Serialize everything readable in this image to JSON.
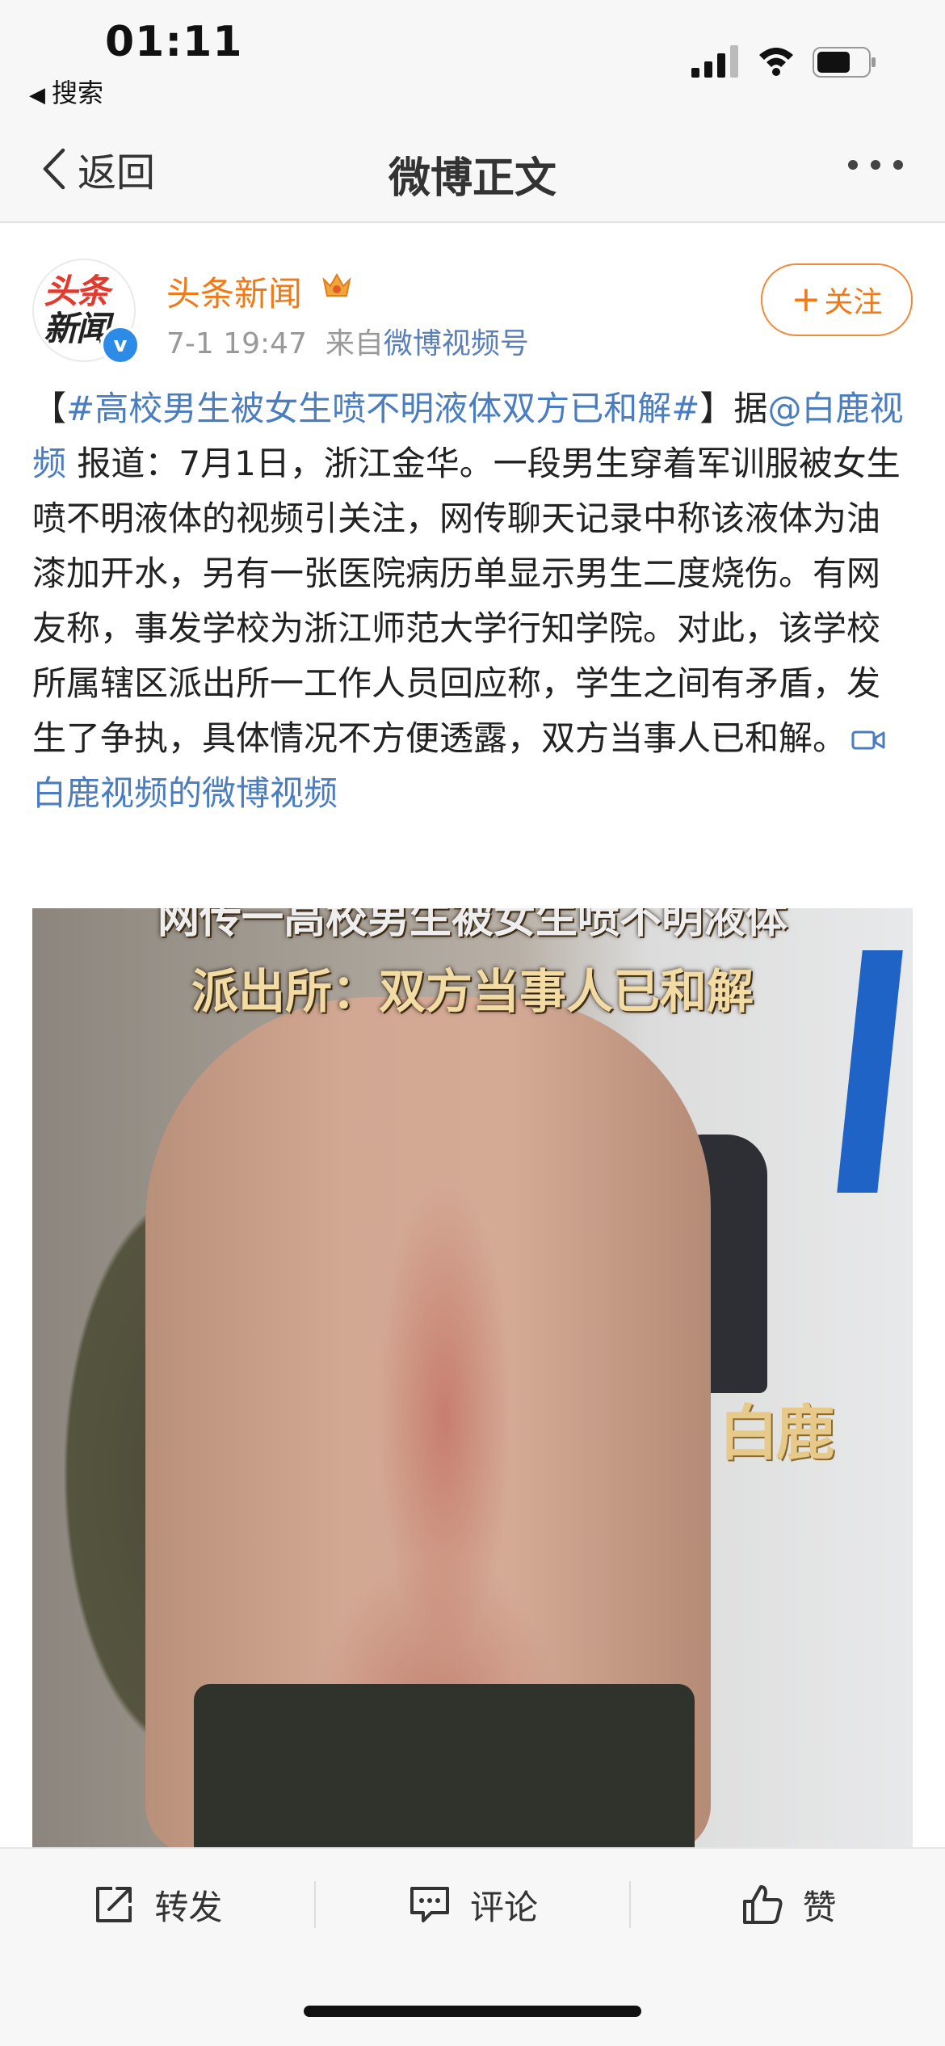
{
  "status_bar": {
    "time": "01:11",
    "back_app": "搜索"
  },
  "navbar": {
    "back_label": "返回",
    "title": "微博正文"
  },
  "post": {
    "author": "头条新闻",
    "avatar_text_line1": "头条",
    "avatar_text_line2": "新闻",
    "time": "7-1 19:47",
    "source_prefix": "来自",
    "source": "微博视频号",
    "follow_label": "关注",
    "body": {
      "bracket_open": "【",
      "hashtag": "#高校男生被女生喷不明液体双方已和解#",
      "bracket_close": "】",
      "ju": "据",
      "mention": "@白鹿视频",
      "text": " 报道：7月1日，浙江金华。一段男生穿着军训服被女生喷不明液体的视频引关注，网传聊天记录中称该液体为油漆加开水，另有一张医院病历单显示男生二度烧伤。有网友称，事发学校为浙江师范大学行知学院。对此，该学校所属辖区派出所一工作人员回应称，学生之间有矛盾，发生了争执，具体情况不方便透露，双方当事人已和解。",
      "video_link": "白鹿视频的微博视频"
    },
    "image": {
      "caption_line1": "网传一高校男生被女生喷不明液体",
      "caption_line2": "派出所：双方当事人已和解",
      "watermark": "白鹿"
    }
  },
  "toolbar": {
    "repost_label": "转发",
    "comment_label": "评论",
    "like_label": "赞"
  }
}
